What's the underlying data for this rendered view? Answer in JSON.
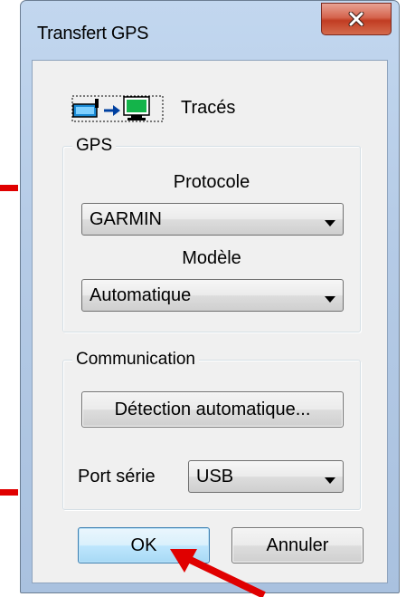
{
  "window": {
    "title": "Transfert GPS",
    "close_icon": "close-icon"
  },
  "header": {
    "icon": "gps-to-computer-icon",
    "label": "Tracés"
  },
  "gps_group": {
    "title": "GPS",
    "protocol_label": "Protocole",
    "protocol_value": "GARMIN",
    "model_label": "Modèle",
    "model_value": "Automatique"
  },
  "comm_group": {
    "title": "Communication",
    "detect_button": "Détection automatique...",
    "port_label": "Port série",
    "port_value": "USB"
  },
  "buttons": {
    "ok": "OK",
    "cancel": "Annuler"
  },
  "colors": {
    "annotation": "#e00000",
    "titlebar": "#b9cfe9",
    "close_button": "#c74a30",
    "default_button_border": "#3c7fb1"
  }
}
